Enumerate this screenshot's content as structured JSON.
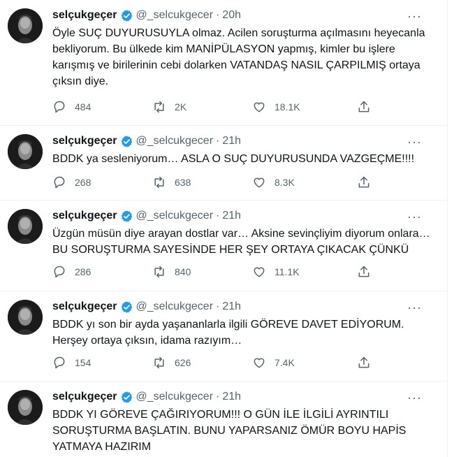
{
  "tweets": [
    {
      "name": "selçukgeçer",
      "handle": "@_selcukgecer",
      "sep": "·",
      "time": "20h",
      "text": "Öyle SUÇ DUYURUSUYLA  olmaz. Acilen soruşturma açılmasını heyecanla\nbekliyorum. Bu ülkede kim MANİPÜLASYON yapmış, kimler bu işlere\nkarışmış ve birilerinin cebi dolarken VATANDAŞ NASIL ÇARPILMIŞ ortaya\nçıksın diye.",
      "replies": "484",
      "retweets": "2K",
      "likes": "18.1K"
    },
    {
      "name": "selçukgeçer",
      "handle": "@_selcukgecer",
      "sep": "·",
      "time": "21h",
      "text": "BDDK ya sesleniyorum… ASLA O SUÇ DUYURUSUNDA VAZGEÇME!!!!",
      "replies": "268",
      "retweets": "638",
      "likes": "8.3K"
    },
    {
      "name": "selçukgeçer",
      "handle": "@_selcukgecer",
      "sep": "·",
      "time": "21h",
      "text": "Üzgün müsün diye arayan dostlar var… Aksine sevinçliyim diyorum onlara…\nBU SORUŞTURMA SAYESİNDE HER ŞEY ORTAYA ÇIKACAK ÇÜNKÜ",
      "replies": "286",
      "retweets": "840",
      "likes": "11.1K"
    },
    {
      "name": "selçukgeçer",
      "handle": "@_selcukgecer",
      "sep": "·",
      "time": "21h",
      "text": "BDDK yı son bir ayda yaşananlarla ilgili GÖREVE DAVET EDİYORUM.\nHerşey ortaya çıksın, idama razıyım…",
      "replies": "154",
      "retweets": "626",
      "likes": "7.4K"
    },
    {
      "name": "selçukgeçer",
      "handle": "@_selcukgecer",
      "sep": "·",
      "time": "21h",
      "text": "BDDK YI GÖREVE ÇAĞIRIYORUM!!! O GÜN İLE İLGİLİ AYRINTILI\nSORUŞTURMA BAŞLATIN. BUNU YAPARSANIZ ÖMÜR BOYU HAPİS\nYATMAYA HAZIRIM"
    }
  ],
  "more_glyph": "···",
  "icons": {
    "verified": "verified-badge-icon",
    "reply": "reply-icon",
    "retweet": "retweet-icon",
    "like": "heart-icon",
    "share": "share-icon"
  },
  "colors": {
    "verified": "#1d9bf0",
    "muted": "#536471",
    "text": "#0f1419",
    "divider": "#eff3f4"
  }
}
